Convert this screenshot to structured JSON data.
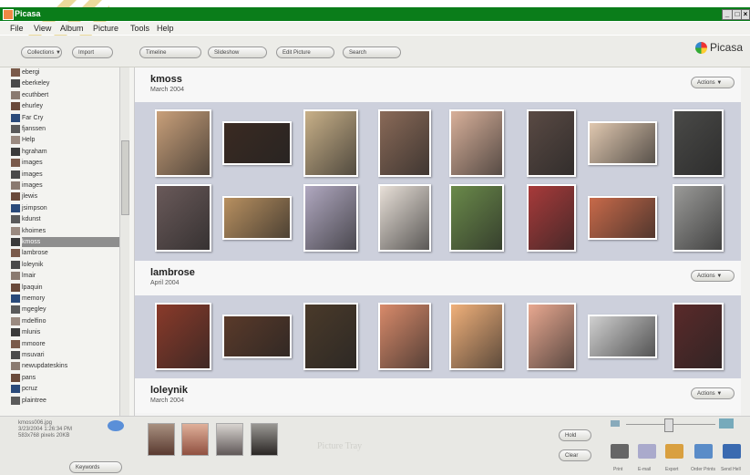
{
  "window": {
    "title": "Picasa"
  },
  "menu": [
    "File",
    "View",
    "Album",
    "Picture",
    "Tools",
    "Help"
  ],
  "toolbar": {
    "collections": "Collections ▼",
    "import": "Import",
    "timeline": "Timeline",
    "slideshow": "Slideshow",
    "edit_picture": "Edit Picture",
    "search": "Search",
    "logo": "Picasa"
  },
  "sidebar": {
    "items": [
      "ebergi",
      "eberkeley",
      "ecuthbert",
      "ehurley",
      "Far Cry",
      "fjanssen",
      "Help",
      "hgraham",
      "images",
      "images",
      "images",
      "jlewis",
      "jsimpson",
      "kdunst",
      "khoimes",
      "kmoss",
      "lambrose",
      "loleynik",
      "lmair",
      "lpaquin",
      "memory",
      "mgegley",
      "mdelfino",
      "mlunis",
      "mmoore",
      "msuvari",
      "newupdateskins",
      "pans",
      "pcruz",
      "plaintree"
    ],
    "selected": 15
  },
  "folders": [
    {
      "name": "kmoss",
      "date": "March 2004",
      "actions": "Actions ▼",
      "rows": 2,
      "count": 16
    },
    {
      "name": "lambrose",
      "date": "April 2004",
      "actions": "Actions ▼",
      "rows": 1,
      "count": 8
    },
    {
      "name": "loleynik",
      "date": "March 2004",
      "actions": "Actions ▼",
      "rows": 0,
      "count": 0
    }
  ],
  "tray": {
    "file": "kmoss006.jpg",
    "datetime": "3/23/2004 1:26:34 PM",
    "size": "583x768 pixels  20KB",
    "keywords": "Keywords",
    "hold": "Hold",
    "clear": "Clear",
    "watermark": "Picture Tray",
    "buttons": [
      "Print",
      "E-mail",
      "Export",
      "Order Prints",
      "Send Hell"
    ]
  },
  "colors": {
    "titlebar": "#0a7d1a",
    "band": "#cdd0dc",
    "selected": "#8e8e8e"
  }
}
